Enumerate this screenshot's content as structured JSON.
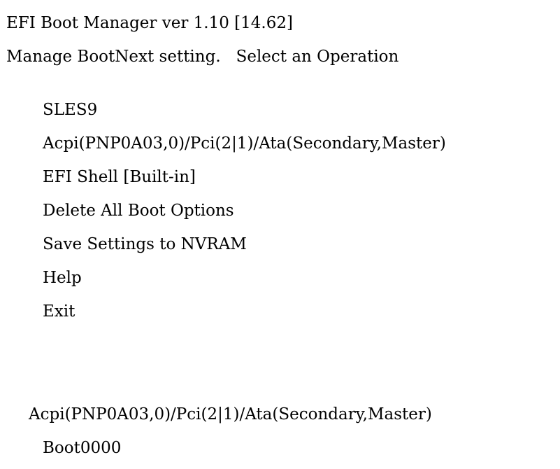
{
  "header": {
    "title": "EFI Boot Manager ver 1.10 [14.62]",
    "subtitle": "Manage BootNext setting.   Select an Operation"
  },
  "menu": {
    "items": [
      {
        "label": "SLES9"
      },
      {
        "label": "Acpi(PNP0A03,0)/Pci(2|1)/Ata(Secondary,Master)"
      },
      {
        "label": "EFI Shell [Built-in]"
      },
      {
        "label": "Delete All Boot Options"
      },
      {
        "label": "Save Settings to NVRAM"
      },
      {
        "label": "Help"
      },
      {
        "label": "Exit"
      }
    ]
  },
  "status": {
    "device_path": "Acpi(PNP0A03,0)/Pci(2|1)/Ata(Secondary,Master)",
    "boot_option": "Boot0000"
  },
  "colors": {
    "background": "#ffffff",
    "text": "#000000"
  }
}
